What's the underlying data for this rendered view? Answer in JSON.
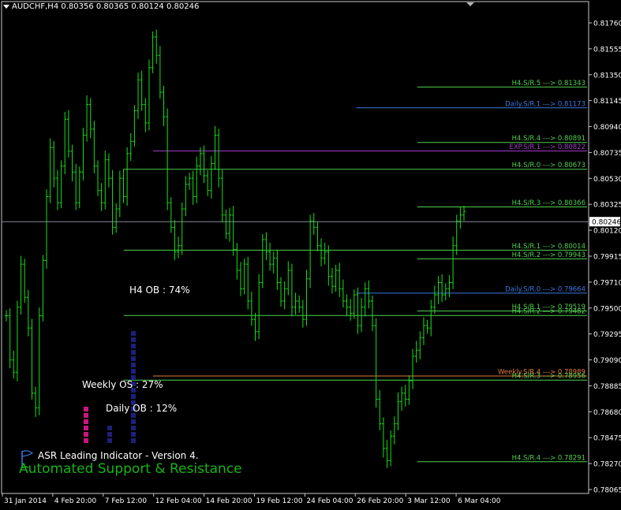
{
  "header": {
    "symbol_line": "AUDCHF,H4 0.80356 0.80365 0.80124 0.80246"
  },
  "indicator": {
    "title": "ASR Leading Indicator - Version 4.",
    "subtitle": "Automated Support & Resistance"
  },
  "meters": [
    {
      "label": "Weekly OS : 27%",
      "value": 27,
      "color": "#c8167f"
    },
    {
      "label": "Daily OB : 12%",
      "value": 12,
      "color": "#1f1f7a"
    },
    {
      "label": "H4 OB : 74%",
      "value": 74,
      "color": "#1f1f7a"
    }
  ],
  "colors": {
    "candle": "#16e016",
    "grid_axis": "#c8c8c8",
    "current_price_line": "#8a8aa0"
  },
  "chart_data": {
    "type": "line",
    "style": "candlestick-bars",
    "title": "AUDCHF,H4",
    "xlabel": "",
    "ylabel": "",
    "ylim": [
      0.78065,
      0.81865
    ],
    "y_ticks": [
      "0.81760",
      "0.81555",
      "0.81350",
      "0.81145",
      "0.80940",
      "0.80735",
      "0.80530",
      "0.80325",
      "0.80120",
      "0.79915",
      "0.79710",
      "0.79500",
      "0.79295",
      "0.79090",
      "0.78885",
      "0.78680",
      "0.78475",
      "0.78270",
      "0.78065"
    ],
    "x_ticks": [
      "31 Jan 2014",
      "4 Feb 20:00",
      "7 Feb 12:00",
      "12 Feb 04:00",
      "14 Feb 20:00",
      "19 Feb 12:00",
      "24 Feb 04:00",
      "26 Feb 20:00",
      "3 Mar 12:00",
      "6 Mar 04:00"
    ],
    "current_price": 0.80246,
    "current_price_label": "0.80246",
    "price_series": [
      0.7948,
      0.7912,
      0.7902,
      0.7955,
      0.799,
      0.7963,
      0.7938,
      0.7885,
      0.7873,
      0.7948,
      0.7993,
      0.8045,
      0.8085,
      0.806,
      0.804,
      0.807,
      0.8108,
      0.8082,
      0.8065,
      0.804,
      0.8065,
      0.8095,
      0.812,
      0.81,
      0.807,
      0.805,
      0.804,
      0.8075,
      0.806,
      0.802,
      0.8035,
      0.806,
      0.8045,
      0.808,
      0.809,
      0.8115,
      0.814,
      0.812,
      0.8105,
      0.815,
      0.8175,
      0.816,
      0.813,
      0.811,
      0.804,
      0.802,
      0.8,
      0.8005,
      0.8035,
      0.8055,
      0.806,
      0.8045,
      0.807,
      0.808,
      0.8062,
      0.805,
      0.8072,
      0.8095,
      0.806,
      0.803,
      0.8015,
      0.803,
      0.8002,
      0.7985,
      0.797,
      0.799,
      0.796,
      0.7945,
      0.7935,
      0.7975,
      0.801,
      0.8,
      0.799,
      0.7995,
      0.7975,
      0.796,
      0.797,
      0.7985,
      0.7955,
      0.796,
      0.7955,
      0.7945,
      0.7978,
      0.8025,
      0.802,
      0.8005,
      0.7995,
      0.8,
      0.798,
      0.7972,
      0.7985,
      0.797,
      0.796,
      0.7955,
      0.795,
      0.7965,
      0.794,
      0.7955,
      0.797,
      0.796,
      0.794,
      0.788,
      0.786,
      0.784,
      0.783,
      0.785,
      0.786,
      0.7878,
      0.7885,
      0.788,
      0.7895,
      0.7915,
      0.792,
      0.793,
      0.794,
      0.7938,
      0.7955,
      0.7965,
      0.7975,
      0.7965,
      0.797,
      0.7975,
      0.8005,
      0.8025,
      0.803,
      0.8033
    ],
    "levels": [
      {
        "label": "H4.S/R.5 ---> 0.81343",
        "value": 0.81343,
        "color": "#4fcf4f",
        "start": 0.708
      },
      {
        "label": "Daily.S/R.1 ---> 0.81173",
        "value": 0.81173,
        "color": "#3c78e0",
        "start": 0.604
      },
      {
        "label": "H4.S/R.4 ---> 0.80891",
        "value": 0.80891,
        "color": "#4fcf4f",
        "start": 0.708
      },
      {
        "label": "EXP.S/R.1 ---> 0.80822",
        "value": 0.80822,
        "color": "#a23cc8",
        "start": 0.258
      },
      {
        "label": "H4.S/R.0 ---> 0.80673",
        "value": 0.80673,
        "color": "#4fcf4f",
        "start": 0.208
      },
      {
        "label": "H4.S/R.3 ---> 0.80366",
        "value": 0.80366,
        "color": "#4fcf4f",
        "start": 0.708
      },
      {
        "label": "H4.S/R.1 ---> 0.80014",
        "value": 0.80014,
        "color": "#4fcf4f",
        "start": 0.208
      },
      {
        "label": "H4.S/R.2 ---> 0.79943",
        "value": 0.79943,
        "color": "#4fcf4f",
        "start": 0.708
      },
      {
        "label": "Daily.S/R.0 ---> 0.79664",
        "value": 0.79664,
        "color": "#3c78e0",
        "start": 0.604
      },
      {
        "label": "H4.S/R.1 ---> 0.79519",
        "value": 0.79519,
        "color": "#4fcf4f",
        "start": 0.708
      },
      {
        "label": "H4.S/R.2 ---> 0.79482",
        "value": 0.79482,
        "color": "#4fcf4f",
        "start": 0.208
      },
      {
        "label": "Weekly.S/R.4 ---> 0.78989",
        "value": 0.78989,
        "color": "#e07a3a",
        "start": 0.258
      },
      {
        "label": "H4.S/R.3 ---> 0.78956",
        "value": 0.78956,
        "color": "#4fcf4f",
        "start": 0.208
      },
      {
        "label": "H4.S/R.4 ---> 0.78291",
        "value": 0.78291,
        "color": "#4fcf4f",
        "start": 0.708
      }
    ]
  }
}
